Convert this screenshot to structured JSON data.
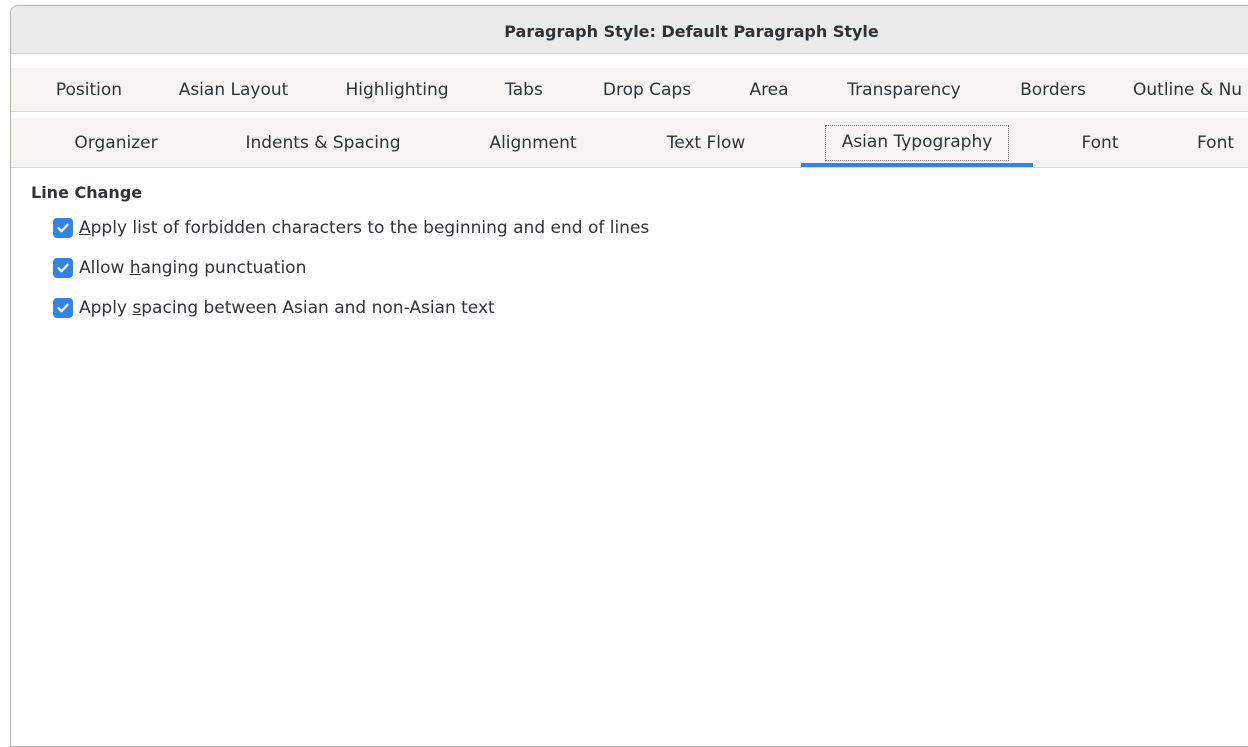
{
  "window": {
    "title": "Paragraph Style: Default Paragraph Style"
  },
  "tabs_row1": [
    {
      "label": "Position"
    },
    {
      "label": "Asian Layout"
    },
    {
      "label": "Highlighting"
    },
    {
      "label": "Tabs"
    },
    {
      "label": "Drop Caps"
    },
    {
      "label": "Area"
    },
    {
      "label": "Transparency"
    },
    {
      "label": "Borders"
    },
    {
      "label": "Outline & Nu"
    }
  ],
  "tabs_row2": [
    {
      "label": "Organizer"
    },
    {
      "label": "Indents & Spacing"
    },
    {
      "label": "Alignment"
    },
    {
      "label": "Text Flow"
    },
    {
      "label": "Asian Typography",
      "active": true
    },
    {
      "label": "Font"
    },
    {
      "label": "Font"
    }
  ],
  "content": {
    "section_title": "Line Change",
    "options": [
      {
        "pre": "",
        "mnemonic": "A",
        "post": "pply list of forbidden characters to the beginning and end of lines",
        "checked": true
      },
      {
        "pre": "Allow ",
        "mnemonic": "h",
        "post": "anging punctuation",
        "checked": true
      },
      {
        "pre": "Apply ",
        "mnemonic": "s",
        "post": "pacing between Asian and non-Asian text",
        "checked": true
      }
    ]
  },
  "colors": {
    "accent": "#3584e4",
    "titlebar": "#ebebeb",
    "tabbar": "#f6f5f4"
  }
}
